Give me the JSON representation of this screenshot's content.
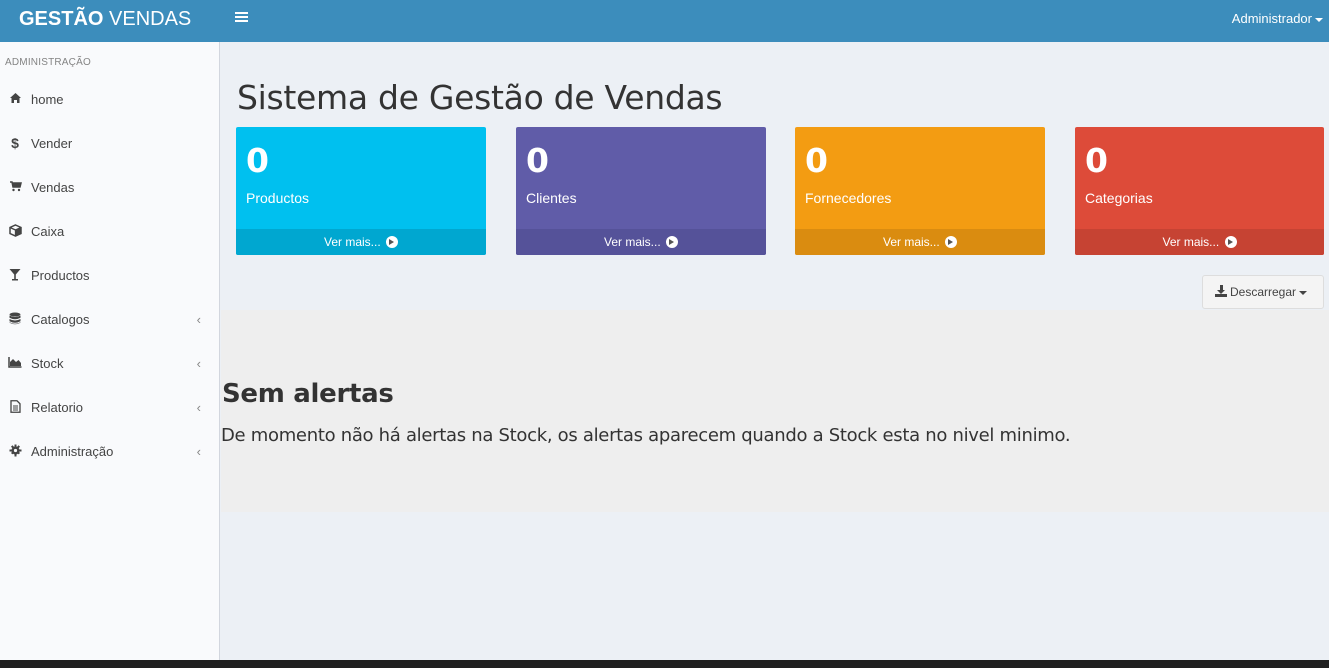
{
  "header": {
    "logo_bold": "GESTÃO",
    "logo_rest": " VENDAS",
    "user": "Administrador"
  },
  "sidebar": {
    "section_title": "ADMINISTRAÇÃO",
    "items": [
      {
        "label": "home",
        "icon": "home-icon",
        "submenu": false
      },
      {
        "label": "Vender",
        "icon": "dollar-icon",
        "submenu": false
      },
      {
        "label": "Vendas",
        "icon": "cart-icon",
        "submenu": false
      },
      {
        "label": "Caixa",
        "icon": "cube-icon",
        "submenu": false
      },
      {
        "label": "Productos",
        "icon": "glass-icon",
        "submenu": false
      },
      {
        "label": "Catalogos",
        "icon": "database-icon",
        "submenu": true
      },
      {
        "label": "Stock",
        "icon": "area-chart-icon",
        "submenu": true
      },
      {
        "label": "Relatorio",
        "icon": "file-text-icon",
        "submenu": true
      },
      {
        "label": "Administração",
        "icon": "cog-icon",
        "submenu": true
      }
    ]
  },
  "main": {
    "title": "Sistema de Gestão de Vendas",
    "boxes": [
      {
        "value": "0",
        "label": "Productos",
        "footer": "Ver mais...",
        "color": "#00c0ef",
        "footer_color": "#00a7d0"
      },
      {
        "value": "0",
        "label": "Clientes",
        "footer": "Ver mais...",
        "color": "#605ca8",
        "footer_color": "#555299"
      },
      {
        "value": "0",
        "label": "Fornecedores",
        "footer": "Ver mais...",
        "color": "#f39c12",
        "footer_color": "#da8c10"
      },
      {
        "value": "0",
        "label": "Categorias",
        "footer": "Ver mais...",
        "color": "#dd4b39",
        "footer_color": "#c64333"
      }
    ],
    "download_button": "Descarregar",
    "alert_title": "Sem alertas",
    "alert_text": "De momento não há alertas na Stock, os alertas aparecem quando a Stock esta no nivel minimo."
  },
  "colors": {
    "header": "#3c8dbc",
    "content_bg": "#ecf0f5",
    "sidebar_bg": "#f9fafc"
  }
}
